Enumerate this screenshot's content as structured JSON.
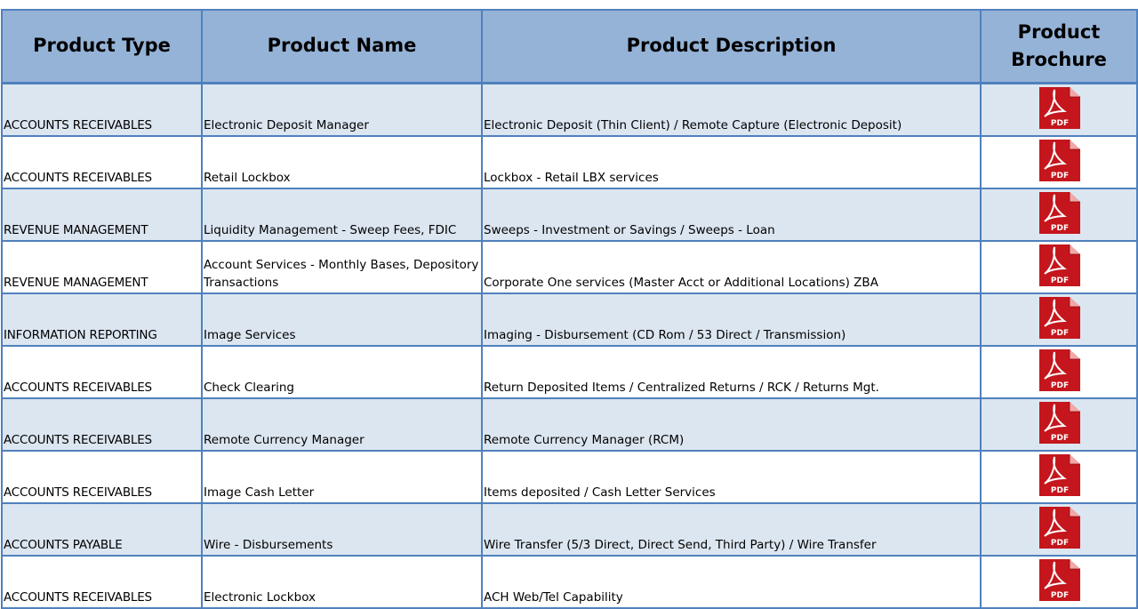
{
  "headers": {
    "type": "Product Type",
    "name": "Product Name",
    "description": "Product Description",
    "brochure_line1": "Product",
    "brochure_line2": "Brochure"
  },
  "rows": [
    {
      "type": "ACCOUNTS RECEIVABLES",
      "name": "Electronic Deposit Manager",
      "description": "Electronic Deposit (Thin Client) / Remote Capture (Electronic Deposit)",
      "brochure": "PDF"
    },
    {
      "type": "ACCOUNTS RECEIVABLES",
      "name": "Retail Lockbox",
      "description": "Lockbox - Retail LBX services",
      "brochure": "PDF"
    },
    {
      "type": "REVENUE MANAGEMENT",
      "name": "Liquidity Management - Sweep Fees, FDIC",
      "description": "Sweeps - Investment or Savings / Sweeps - Loan",
      "brochure": "PDF"
    },
    {
      "type": "REVENUE MANAGEMENT",
      "name": "Account Services - Monthly Bases, Depository Transactions",
      "description": "Corporate One services (Master Acct or Additional Locations) ZBA",
      "brochure": "PDF"
    },
    {
      "type": "INFORMATION REPORTING",
      "name": "Image Services",
      "description": "Imaging - Disbursement (CD Rom / 53 Direct / Transmission)",
      "brochure": "PDF"
    },
    {
      "type": "ACCOUNTS RECEIVABLES",
      "name": "Check Clearing",
      "description": "Return Deposited Items / Centralized Returns / RCK / Returns Mgt.",
      "brochure": "PDF"
    },
    {
      "type": "ACCOUNTS RECEIVABLES",
      "name": "Remote Currency Manager",
      "description": "Remote Currency Manager (RCM)",
      "brochure": "PDF"
    },
    {
      "type": "ACCOUNTS RECEIVABLES",
      "name": "Image Cash Letter",
      "description": "Items deposited / Cash Letter Services",
      "brochure": "PDF"
    },
    {
      "type": "ACCOUNTS PAYABLE",
      "name": "Wire - Disbursements",
      "description": "Wire Transfer (5/3 Direct, Direct Send, Third Party) / Wire Transfer",
      "brochure": "PDF"
    },
    {
      "type": "ACCOUNTS RECEIVABLES",
      "name": "Electronic Lockbox",
      "description": "ACH Web/Tel Capability",
      "brochure": "PDF"
    }
  ],
  "colors": {
    "header_bg": "#95b3d7",
    "band_bg": "#dce6f1",
    "grid": "#4f81bd",
    "pdf_red": "#c4161c"
  },
  "icon": "pdf-file-icon"
}
